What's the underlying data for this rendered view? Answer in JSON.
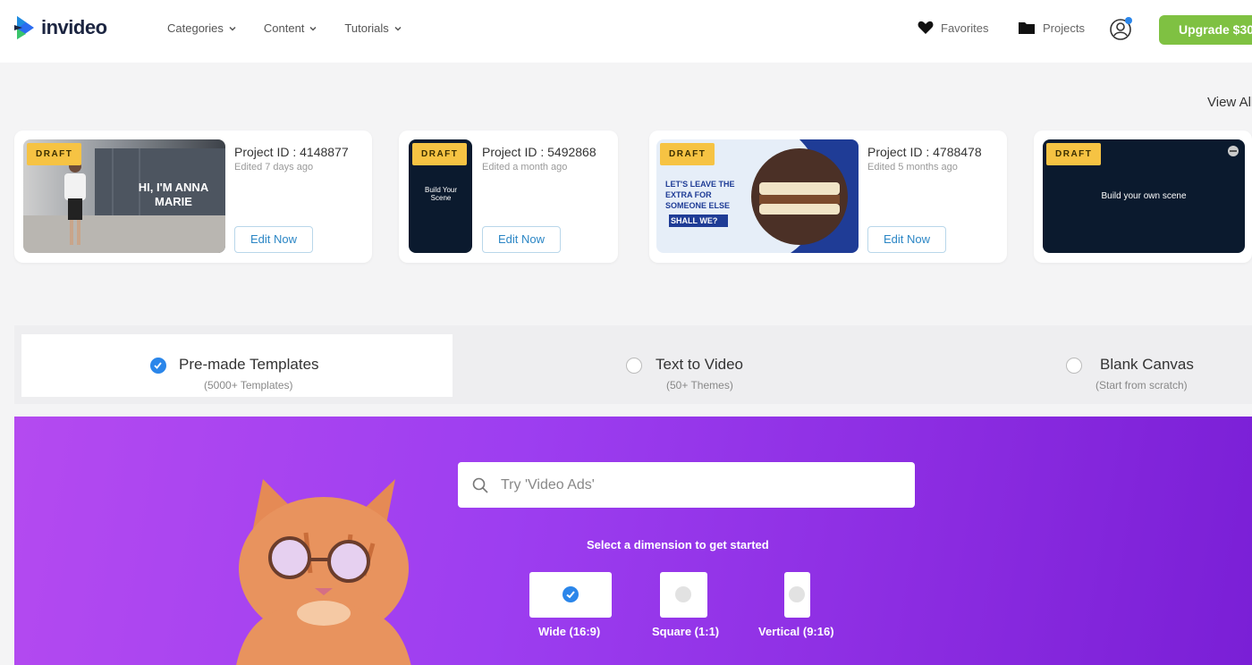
{
  "brand": {
    "name": "invideo",
    "accent": "#2b86ea",
    "upgrade_color": "#7fc142",
    "hero_color": "#9d3ef0"
  },
  "nav": {
    "items": [
      {
        "label": "Categories",
        "icon": "chevron-down-icon"
      },
      {
        "label": "Content",
        "icon": "chevron-down-icon"
      },
      {
        "label": "Tutorials",
        "icon": "chevron-down-icon"
      }
    ]
  },
  "header": {
    "favorites_label": "Favorites",
    "projects_label": "Projects",
    "upgrade_label": "Upgrade $30"
  },
  "recent": {
    "view_all_label": "View All",
    "draft_label": "DRAFT",
    "edit_label": "Edit Now",
    "cards": [
      {
        "project_id": "Project ID : 4148877",
        "edited": "Edited 7 days ago",
        "thumb_text": "HI, I'M ANNA MARIE"
      },
      {
        "project_id": "Project ID : 5492868",
        "edited": "Edited a month ago",
        "thumb_text": "Build Your Scene"
      },
      {
        "project_id": "Project ID : 4788478",
        "edited": "Edited 5 months ago",
        "thumb_text": "LET'S LEAVE THE EXTRA FOR SOMEONE ELSE",
        "thumb_highlight": "SHALL WE?"
      },
      {
        "thumb_text": "Build your own scene"
      }
    ]
  },
  "modes": [
    {
      "title": "Pre-made Templates",
      "subtitle": "(5000+ Templates)",
      "selected": true
    },
    {
      "title": "Text to Video",
      "subtitle": "(50+ Themes)",
      "selected": false
    },
    {
      "title": "Blank Canvas",
      "subtitle": "(Start from scratch)",
      "selected": false
    }
  ],
  "hero": {
    "search_placeholder": "Try 'Video Ads'",
    "dimension_prompt": "Select a dimension to get started",
    "dimensions": [
      {
        "label": "Wide (16:9)",
        "selected": true
      },
      {
        "label": "Square (1:1)",
        "selected": false
      },
      {
        "label": "Vertical (9:16)",
        "selected": false
      }
    ]
  }
}
